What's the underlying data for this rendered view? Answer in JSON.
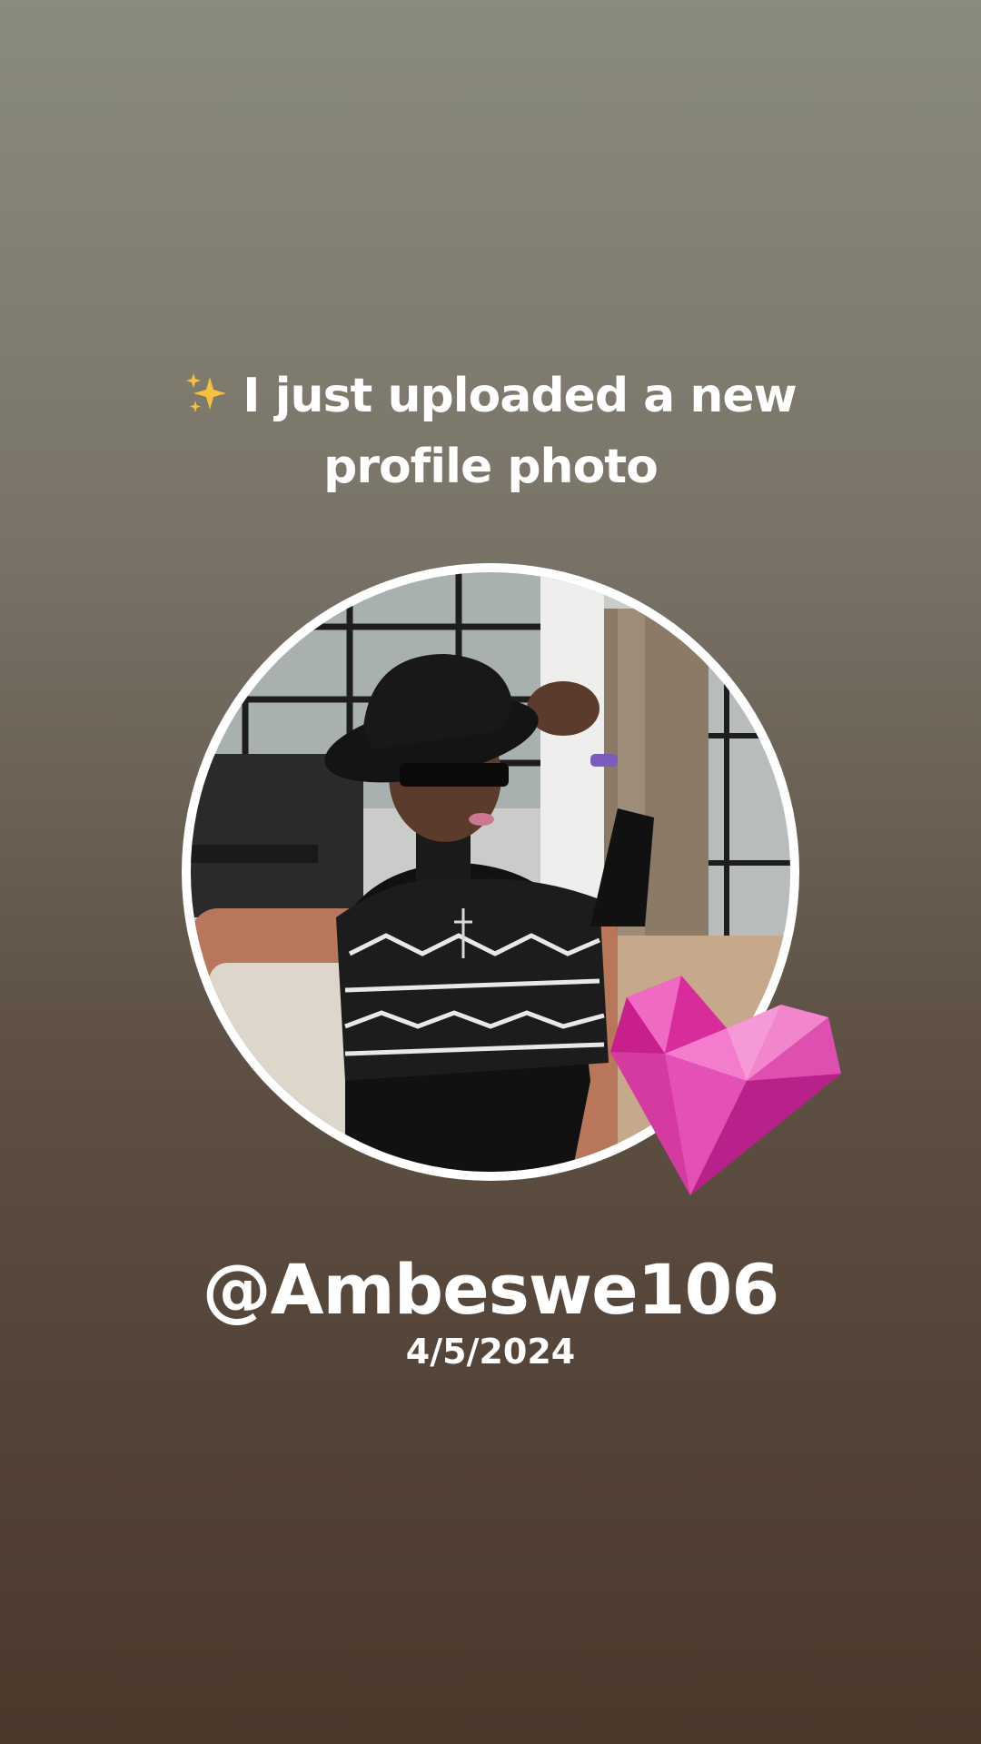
{
  "post": {
    "sparkle_icon": "sparkles-icon",
    "headline_line1": "I just uploaded a new",
    "headline_line2": "profile photo",
    "username": "@Ambeswe106",
    "date": "4/5/2024"
  },
  "decor": {
    "heart_icon": "gem-heart-icon",
    "heart_color": "#e23aa6",
    "ring_color": "#ffffff"
  }
}
